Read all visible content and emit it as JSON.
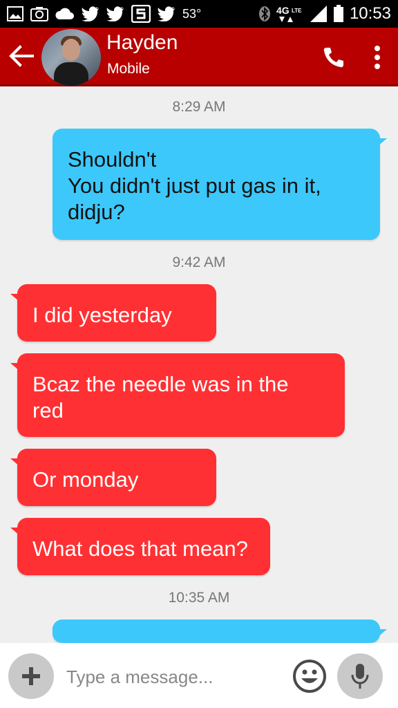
{
  "status_bar": {
    "icons_left": [
      "gallery-icon",
      "camera-icon",
      "cloud-icon",
      "twitter-icon",
      "twitter-icon",
      "s-app-icon",
      "twitter-icon"
    ],
    "temperature": "53°",
    "network": "4G LTE",
    "time": "10:53"
  },
  "header": {
    "contact_name": "Hayden",
    "contact_subtitle": "Mobile",
    "accent_color": "#b80000"
  },
  "conversation": {
    "timestamps": [
      "8:29 AM",
      "9:42 AM",
      "10:35 AM"
    ],
    "outgoing": [
      {
        "lines": [
          "Shouldn't",
          "You didn't just put gas in it,",
          "didju?"
        ]
      }
    ],
    "incoming": [
      {
        "lines": [
          "I did yesterday"
        ]
      },
      {
        "lines": [
          "Bcaz the needle was in the",
          "red"
        ]
      },
      {
        "lines": [
          "Or monday"
        ]
      },
      {
        "lines": [
          "What does that mean?"
        ]
      }
    ],
    "incoming_color": "#ff3033",
    "outgoing_color": "#3cc8fb"
  },
  "composer": {
    "placeholder": "Type a message..."
  }
}
